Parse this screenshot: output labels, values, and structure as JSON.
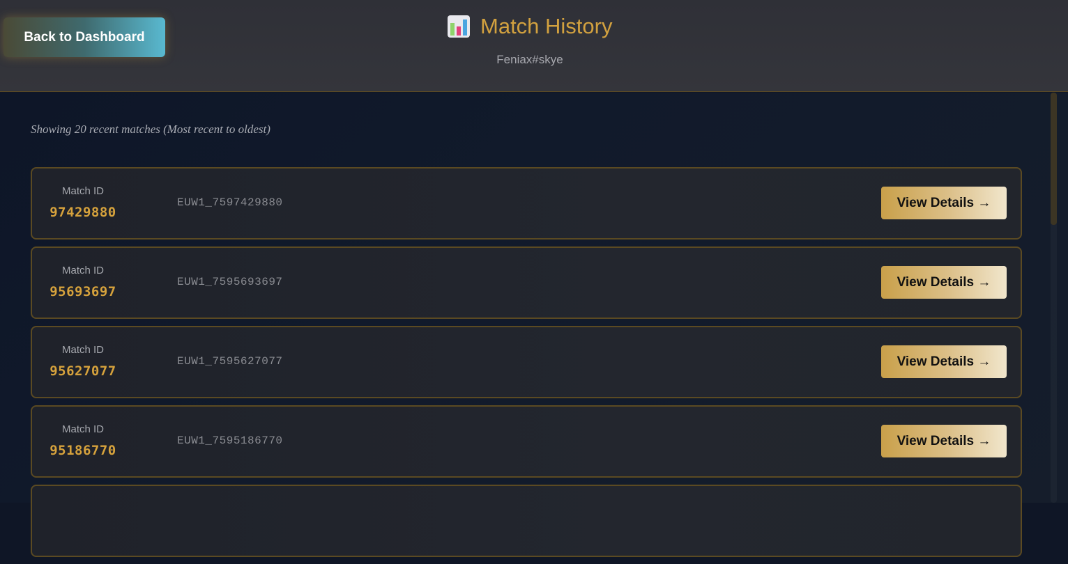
{
  "header": {
    "back_label": "Back to Dashboard",
    "title": "Match History",
    "title_icon": "bar-chart-icon",
    "subtitle": "Feniax#skye"
  },
  "main": {
    "showing_text": "Showing 20 recent matches (Most recent to oldest)",
    "matches": [
      {
        "label": "Match ID",
        "short_id": "97429880",
        "full_id": "EUW1_7597429880",
        "button": "View Details →"
      },
      {
        "label": "Match ID",
        "short_id": "95693697",
        "full_id": "EUW1_7595693697",
        "button": "View Details →"
      },
      {
        "label": "Match ID",
        "short_id": "95627077",
        "full_id": "EUW1_7595627077",
        "button": "View Details →"
      },
      {
        "label": "Match ID",
        "short_id": "95186770",
        "full_id": "EUW1_7595186770",
        "button": "View Details →"
      }
    ]
  },
  "colors": {
    "accent_gold": "#d2a13f",
    "card_border": "#5b4a22",
    "background": "#0f1626"
  }
}
